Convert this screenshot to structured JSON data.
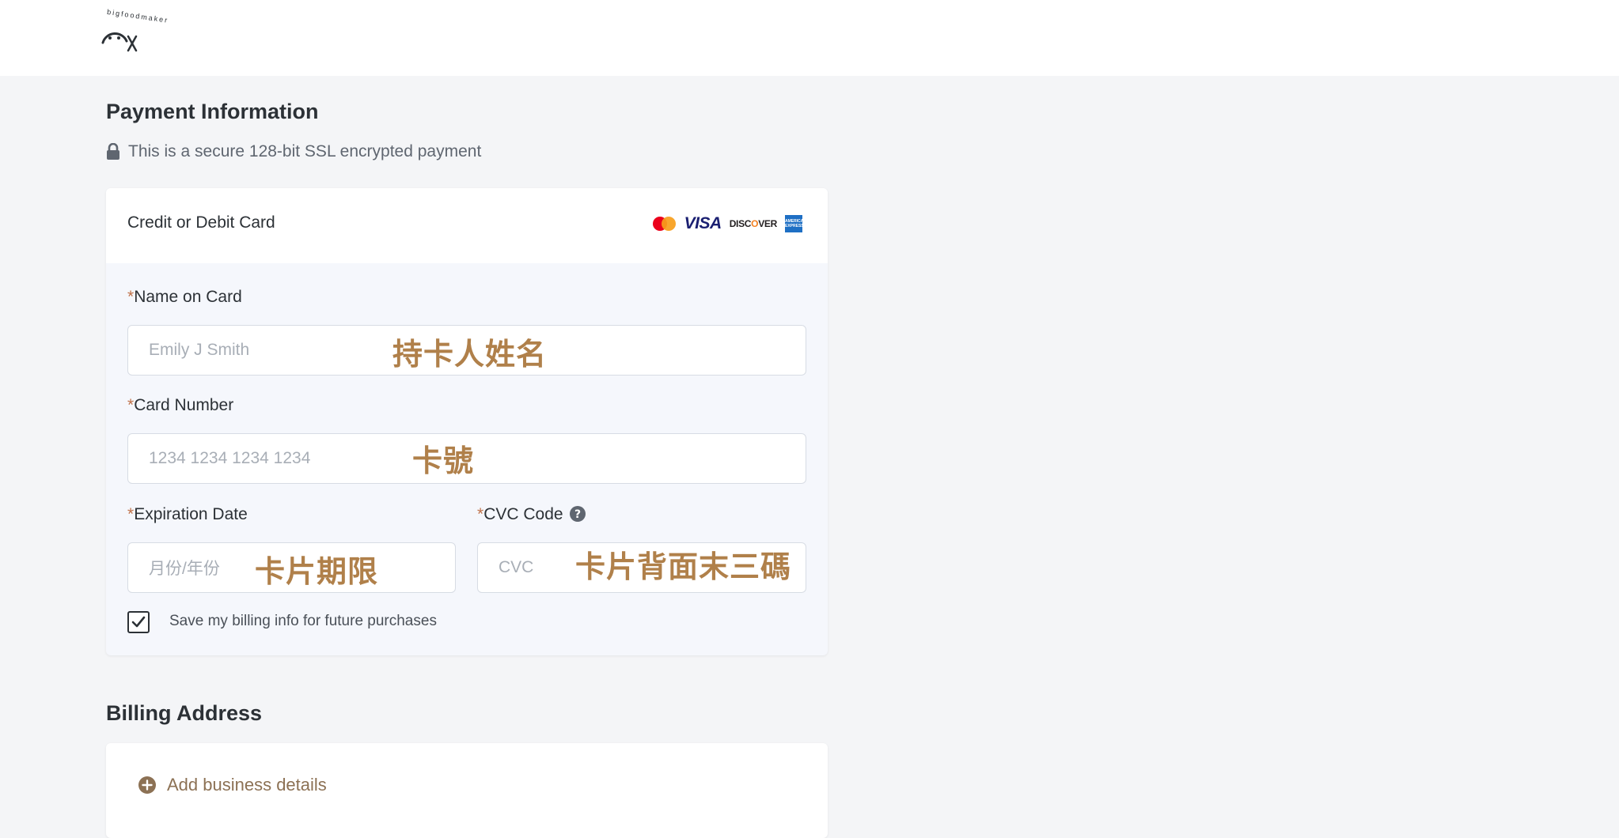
{
  "header": {
    "logo_text": "bigfoodmaker",
    "logo_icon": "smiley-fork-logo"
  },
  "payment": {
    "title": "Payment Information",
    "secure_note": "This is a secure 128-bit SSL encrypted payment",
    "lock_icon": "lock-icon",
    "card_header": "Credit or Debit Card",
    "brands": [
      "Mastercard",
      "VISA",
      "DISCOVER",
      "AMEX"
    ],
    "brand_visa": "VISA",
    "brand_discover_1": "DISC",
    "brand_discover_o": "O",
    "brand_discover_2": "VER",
    "brand_amex": "AMERICAN EXPRESS",
    "required_mark": "*",
    "name": {
      "label": "Name on Card",
      "placeholder": "Emily J Smith",
      "annotation": "持卡人姓名"
    },
    "card_number": {
      "label": "Card Number",
      "placeholder": "1234 1234 1234 1234",
      "annotation": "卡號"
    },
    "expiry": {
      "label": "Expiration Date",
      "placeholder": "月份/年份",
      "annotation": "卡片期限"
    },
    "cvc": {
      "label": "CVC Code",
      "placeholder": "CVC",
      "annotation": "卡片背面末三碼",
      "help_icon": "question-circle-icon"
    },
    "save_billing": {
      "label": "Save my billing info for future purchases",
      "checked": true
    }
  },
  "billing": {
    "title": "Billing Address",
    "add_business": "Add business details",
    "plus_icon": "plus-circle-icon"
  },
  "colors": {
    "page_bg": "#f4f5f7",
    "panel_bg": "#f5f7fc",
    "required": "#c0724a",
    "annotation": "#b0804a",
    "add_link": "#8c7154"
  }
}
